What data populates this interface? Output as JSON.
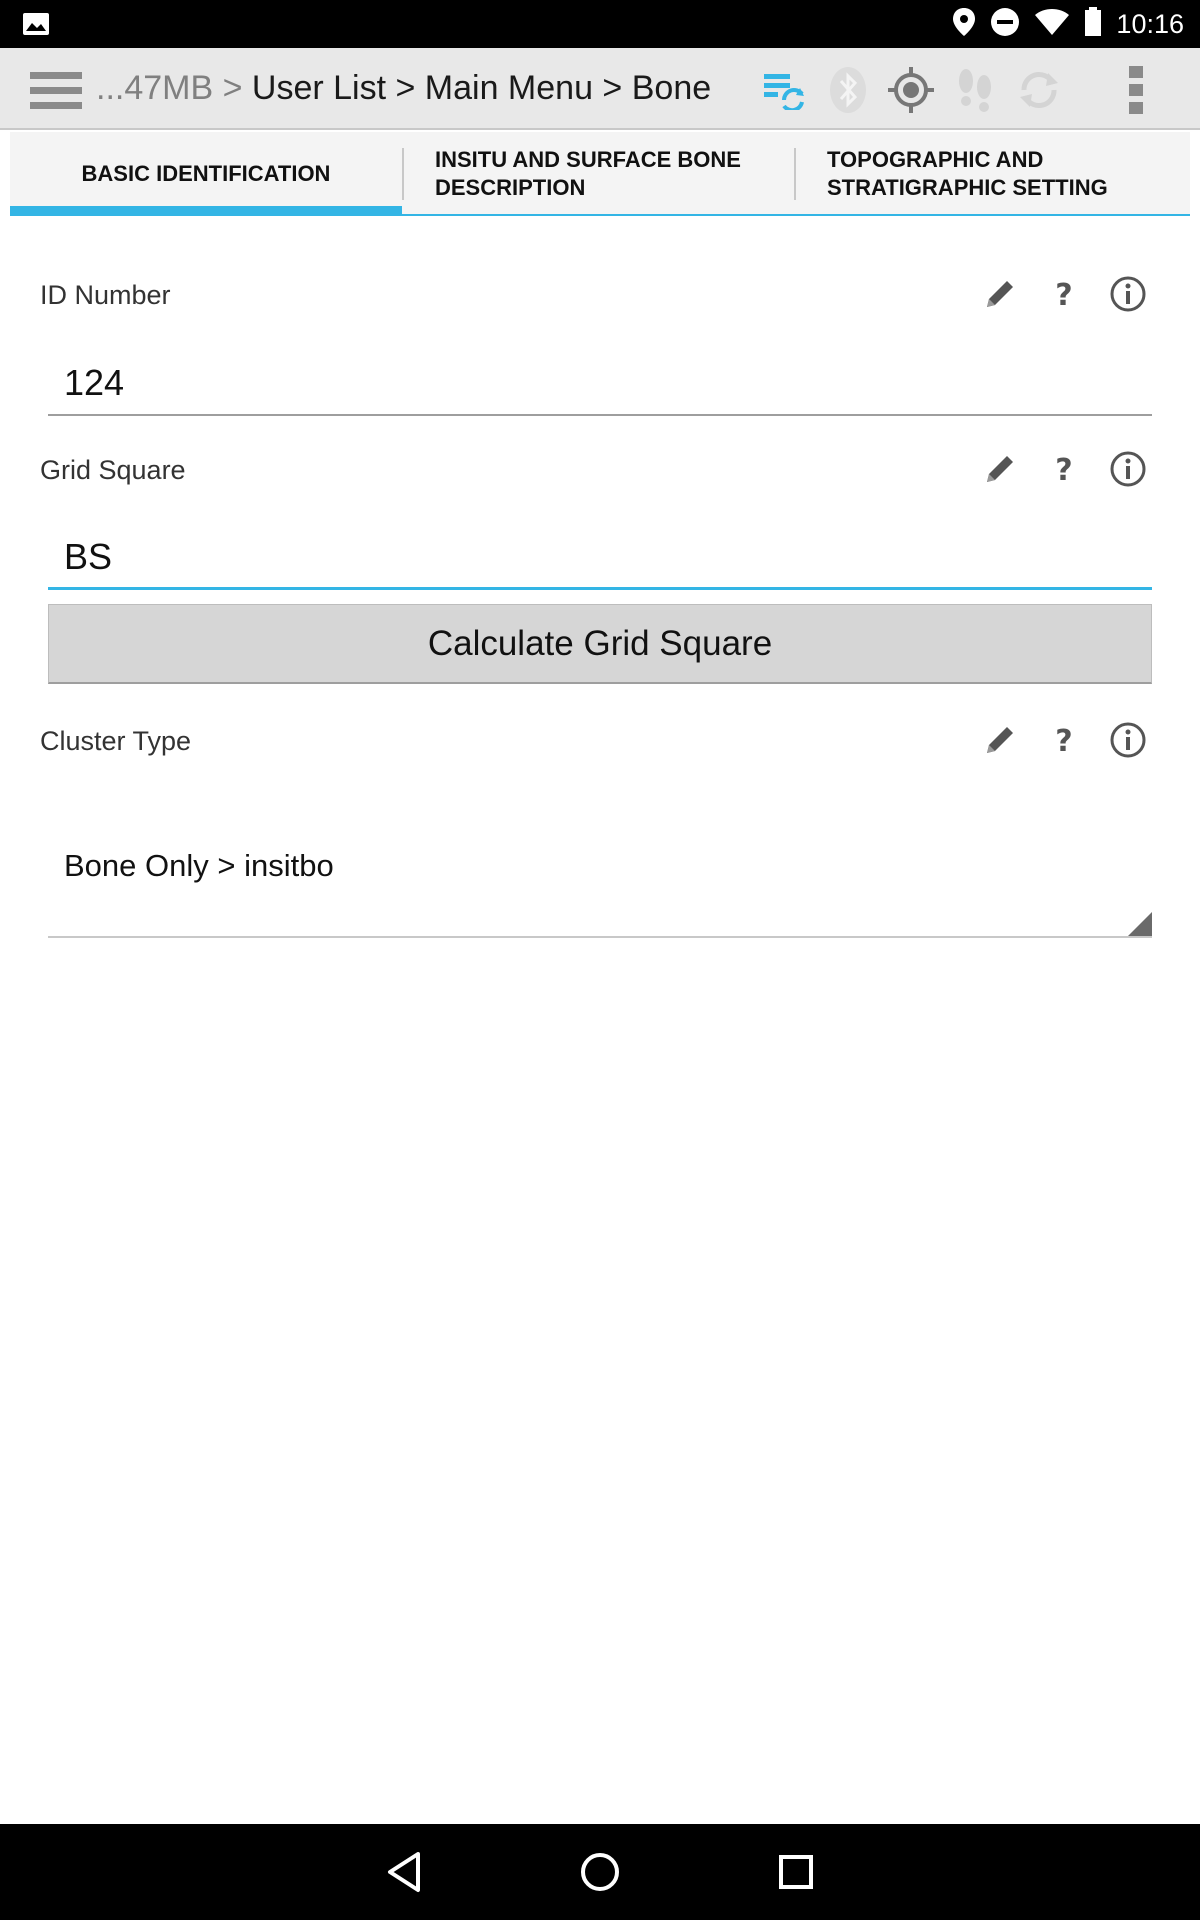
{
  "status_bar": {
    "time": "10:16",
    "icons": [
      "image-icon",
      "location-icon",
      "do-not-disturb-icon",
      "wifi-icon",
      "battery-icon"
    ]
  },
  "action_bar": {
    "breadcrumb_prefix": "...47MB > ",
    "breadcrumb_path": "User List > Main Menu > Bone",
    "icons": [
      "menu-icon",
      "sync-data-icon",
      "bluetooth-icon",
      "gps-target-icon",
      "footsteps-icon",
      "refresh-icon",
      "overflow-menu-icon"
    ],
    "accent_color": "#33b5e5"
  },
  "tabs": [
    {
      "label_line1": "BASIC IDENTIFICATION",
      "label_line2": "",
      "active": true
    },
    {
      "label_line1": "INSITU AND SURFACE BONE",
      "label_line2": "DESCRIPTION",
      "active": false
    },
    {
      "label_line1": "TOPOGRAPHIC AND",
      "label_line2": "STRATIGRAPHIC SETTING",
      "active": false
    }
  ],
  "form": {
    "id_number": {
      "label": "ID Number",
      "value": "124"
    },
    "grid_square": {
      "label": "Grid Square",
      "value": "BS"
    },
    "calculate_button": "Calculate Grid Square",
    "cluster_type": {
      "label": "Cluster Type",
      "value": "Bone Only > insitbo"
    },
    "field_icons": [
      "edit-pencil-icon",
      "help-question-icon",
      "info-icon"
    ]
  },
  "nav_bar": {
    "icons": [
      "back-icon",
      "home-icon",
      "recents-icon"
    ]
  }
}
